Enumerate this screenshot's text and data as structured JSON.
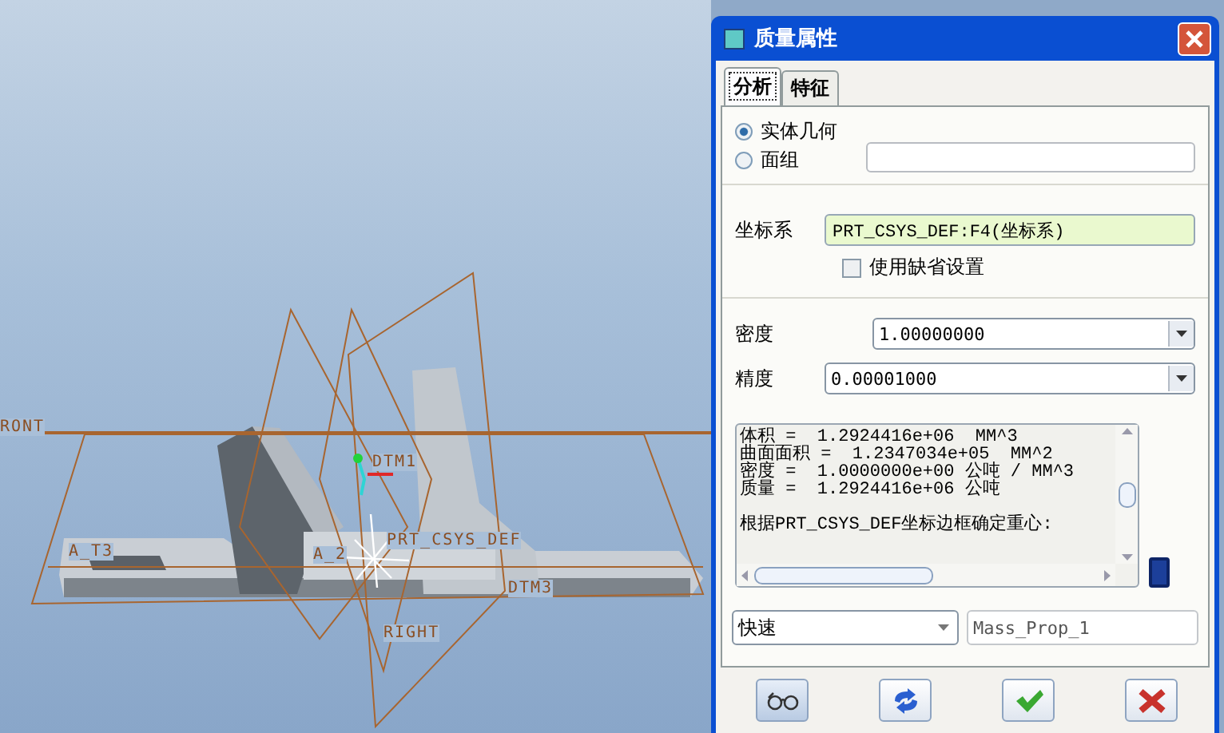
{
  "viewport": {
    "labels": [
      {
        "text": "RONT"
      },
      {
        "text": "A_T3"
      },
      {
        "text": "DTM1"
      },
      {
        "text": "A_2"
      },
      {
        "text": "PRT_CSYS_DEF"
      },
      {
        "text": "DTM3"
      },
      {
        "text": "RIGHT"
      }
    ]
  },
  "dialog": {
    "title": "质量属性",
    "tabs": [
      {
        "label": "分析",
        "selected": true
      },
      {
        "label": "特征",
        "selected": false
      }
    ],
    "geometry_options": [
      {
        "label": "实体几何",
        "selected": true
      },
      {
        "label": "面组",
        "selected": false
      }
    ],
    "coordinate_system": {
      "label": "坐标系",
      "value": "PRT_CSYS_DEF:F4(坐标系)"
    },
    "use_default": {
      "label": "使用缺省设置",
      "checked": false
    },
    "density": {
      "label": "密度",
      "value": "1.00000000"
    },
    "accuracy": {
      "label": "精度",
      "value": "0.00001000"
    },
    "results": [
      "体积 =  1.2924416e+06  MM^3",
      "曲面面积 =  1.2347034e+05  MM^2",
      "密度 =  1.0000000e+00 公吨 / MM^3",
      "质量 =  1.2924416e+06 公吨",
      "根据PRT_CSYS_DEF坐标边框确定重心:"
    ],
    "mode": {
      "value": "快速"
    },
    "name_field": {
      "value": "Mass_Prop_1"
    },
    "buttons": [
      {
        "kind": "glasses"
      },
      {
        "kind": "refresh"
      },
      {
        "kind": "ok"
      },
      {
        "kind": "cancel"
      }
    ]
  }
}
